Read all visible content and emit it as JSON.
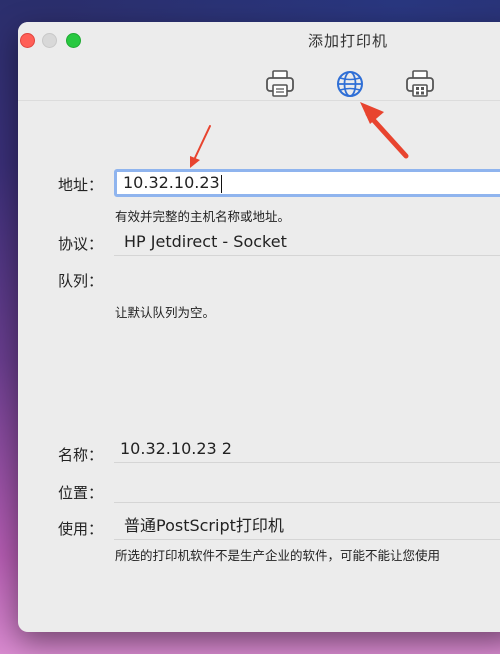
{
  "window": {
    "title": "添加打印机"
  },
  "toolbar": {
    "icons": [
      "printer-icon",
      "globe-icon",
      "windows-printer-icon"
    ],
    "selected": "globe-icon"
  },
  "form": {
    "address": {
      "label": "地址：",
      "value": "10.32.10.23",
      "hint": "有效并完整的主机名称或地址。"
    },
    "protocol": {
      "label": "协议：",
      "value": "HP Jetdirect - Socket"
    },
    "queue": {
      "label": "队列：",
      "value": "",
      "hint": "让默认队列为空。"
    },
    "name": {
      "label": "名称：",
      "value": "10.32.10.23 2"
    },
    "location": {
      "label": "位置：",
      "value": ""
    },
    "use": {
      "label": "使用：",
      "value": "普通PostScript打印机",
      "hint": "所选的打印机软件不是生产企业的软件，可能不能让您使用"
    }
  },
  "colors": {
    "annotation_arrow": "#e8442f",
    "focus_ring": "#8fb4ee",
    "accent": "#2f6fd6"
  }
}
